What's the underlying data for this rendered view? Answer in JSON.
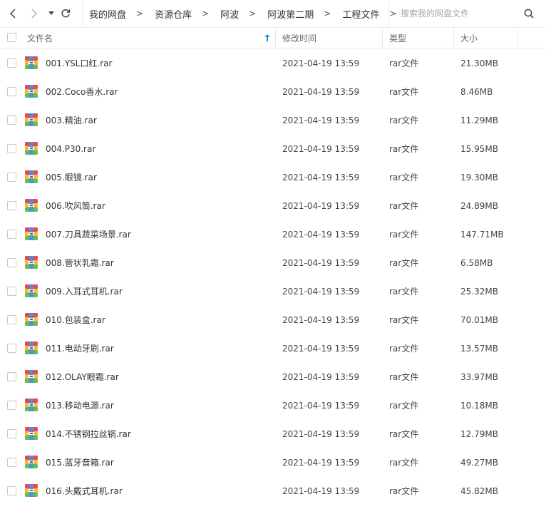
{
  "toolbar": {
    "back_icon": "chevron-left-icon",
    "forward_icon": "chevron-right-icon",
    "history_icon": "caret-down-icon",
    "refresh_icon": "refresh-icon",
    "breadcrumbs": [
      "我的网盘",
      "资源仓库",
      "阿波",
      "阿波第二期",
      "工程文件"
    ],
    "separator": ">",
    "search_placeholder": "搜索我的网盘文件",
    "search_icon": "search-icon"
  },
  "table": {
    "headers": {
      "name": "文件名",
      "modified": "修改时间",
      "type": "类型",
      "size": "大小"
    },
    "sort_icon": "sort-up-arrow-icon",
    "file_icon": "rar-archive-icon",
    "rows": [
      {
        "name": "001.YSL口红.rar",
        "modified": "2021-04-19 13:59",
        "type": "rar文件",
        "size": "21.30MB"
      },
      {
        "name": "002.Coco香水.rar",
        "modified": "2021-04-19 13:59",
        "type": "rar文件",
        "size": "8.46MB"
      },
      {
        "name": "003.精油.rar",
        "modified": "2021-04-19 13:59",
        "type": "rar文件",
        "size": "11.29MB"
      },
      {
        "name": "004.P30.rar",
        "modified": "2021-04-19 13:59",
        "type": "rar文件",
        "size": "15.95MB"
      },
      {
        "name": "005.眼镜.rar",
        "modified": "2021-04-19 13:59",
        "type": "rar文件",
        "size": "19.30MB"
      },
      {
        "name": "006.吹风筒.rar",
        "modified": "2021-04-19 13:59",
        "type": "rar文件",
        "size": "24.89MB"
      },
      {
        "name": "007.刀具蔬菜场景.rar",
        "modified": "2021-04-19 13:59",
        "type": "rar文件",
        "size": "147.71MB"
      },
      {
        "name": "008.管状乳霜.rar",
        "modified": "2021-04-19 13:59",
        "type": "rar文件",
        "size": "6.58MB"
      },
      {
        "name": "009.入耳式耳机.rar",
        "modified": "2021-04-19 13:59",
        "type": "rar文件",
        "size": "25.32MB"
      },
      {
        "name": "010.包装盒.rar",
        "modified": "2021-04-19 13:59",
        "type": "rar文件",
        "size": "70.01MB"
      },
      {
        "name": "011.电动牙刷.rar",
        "modified": "2021-04-19 13:59",
        "type": "rar文件",
        "size": "13.57MB"
      },
      {
        "name": "012.OLAY眼霜.rar",
        "modified": "2021-04-19 13:59",
        "type": "rar文件",
        "size": "33.97MB"
      },
      {
        "name": "013.移动电源.rar",
        "modified": "2021-04-19 13:59",
        "type": "rar文件",
        "size": "10.18MB"
      },
      {
        "name": "014.不锈钢拉丝锅.rar",
        "modified": "2021-04-19 13:59",
        "type": "rar文件",
        "size": "12.79MB"
      },
      {
        "name": "015.蓝牙音箱.rar",
        "modified": "2021-04-19 13:59",
        "type": "rar文件",
        "size": "49.27MB"
      },
      {
        "name": "016.头戴式耳机.rar",
        "modified": "2021-04-19 13:59",
        "type": "rar文件",
        "size": "45.82MB"
      }
    ]
  },
  "colors": {
    "accent": "#1a8fe3",
    "divider": "#e8e8e8",
    "rar_top": "#e8475a",
    "rar_mid": "#f5b83d",
    "rar_bottom": "#5fbf52",
    "rar_band": "#4a8fe0"
  }
}
